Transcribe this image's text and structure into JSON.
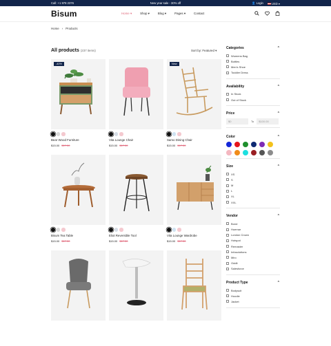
{
  "topbar": {
    "call": "Call: +1 978 2376",
    "promo": "New year sale - 30% off",
    "login": "Login",
    "currency": "USD"
  },
  "header": {
    "logo": "Bisum",
    "nav": [
      {
        "label": "Home",
        "active": true
      },
      {
        "label": "Shop",
        "active": false
      },
      {
        "label": "Blog",
        "active": false
      },
      {
        "label": "Pages",
        "active": false
      },
      {
        "label": "Contact",
        "active": false
      }
    ],
    "icons": [
      "search-icon",
      "heart-icon",
      "bag-icon"
    ]
  },
  "breadcrumb": {
    "home": "Home",
    "sep": "›",
    "current": "Products"
  },
  "listing": {
    "title": "All products",
    "count": "(237 items)",
    "sort_label": "Sort by: Featured"
  },
  "products": [
    {
      "name": "Bear Wood Furniture",
      "price": "$15.00",
      "old_price": "$17.50",
      "badge": "-40%",
      "art": "cabinet",
      "swatches": [
        "#111111",
        "#d9d9d9",
        "#f4c9cf"
      ]
    },
    {
      "name": "Vita Lounge Chair",
      "price": "$15.00",
      "old_price": "$17.50",
      "badge": "",
      "art": "pink-chair",
      "swatches": [
        "#111111",
        "#d6dde6",
        "#f4c9cf"
      ]
    },
    {
      "name": "Samo Dining Chair",
      "price": "$15.00",
      "old_price": "$17.50",
      "badge": "New",
      "art": "rocking-chair",
      "swatches": [
        "#111111",
        "#cfe3f2",
        "#f4c9cf"
      ]
    },
    {
      "name": "Bisum Tea Table",
      "price": "$15.00",
      "old_price": "$17.50",
      "badge": "",
      "art": "tea-table",
      "swatches": [
        "#111111",
        "#d9d9d9",
        "#f4c9cf"
      ]
    },
    {
      "name": "Eliot Reversible Tool",
      "price": "$15.00",
      "old_price": "$17.50",
      "badge": "",
      "art": "stool",
      "swatches": [
        "#111111",
        "#d6dde6",
        "#f4c9cf"
      ]
    },
    {
      "name": "Vita Lounge Wardrobe",
      "price": "$15.00",
      "old_price": "$17.50",
      "badge": "",
      "art": "sideboard",
      "swatches": [
        "#111111",
        "#cfe3f2",
        "#f4c9cf"
      ]
    },
    {
      "name": "",
      "price": "",
      "old_price": "",
      "badge": "",
      "art": "grey-chair",
      "swatches": []
    },
    {
      "name": "",
      "price": "",
      "old_price": "",
      "badge": "",
      "art": "bar-stool",
      "swatches": []
    },
    {
      "name": "",
      "price": "",
      "old_price": "",
      "badge": "",
      "art": "wood-chair",
      "swatches": []
    }
  ],
  "filters": {
    "categories": {
      "title": "Categories",
      "items": [
        "Womens Bag",
        "Bottles",
        "Men's Shoe",
        "Toddler Dress"
      ]
    },
    "availability": {
      "title": "Availability",
      "items": [
        "In Stock",
        "Out of Stock"
      ]
    },
    "price": {
      "title": "Price",
      "from": "$0",
      "to_label": "To",
      "to": "$100.00"
    },
    "color": {
      "title": "Color",
      "colors": [
        "#1427d8",
        "#e5161c",
        "#1f8f2e",
        "#0f2a73",
        "#7e2bb6",
        "#f3c21b",
        "#f4b7c0",
        "#f08c1b",
        "#1de0e0",
        "#9a1f23",
        "#555555",
        "#8c8c8c"
      ]
    },
    "size": {
      "title": "Size",
      "items": [
        "XS",
        "S",
        "M",
        "L",
        "XL",
        "XXL"
      ]
    },
    "vendor": {
      "title": "Vendor",
      "items": [
        "Bond",
        "Huemar",
        "London Crown",
        "Hotspot",
        "Remaster",
        "Infosolutions",
        "Miro",
        "Oddit",
        "Salesforce"
      ]
    },
    "product_type": {
      "title": "Product Type",
      "items": [
        "Bodysuit",
        "Hoodie",
        "Jacket"
      ]
    }
  }
}
